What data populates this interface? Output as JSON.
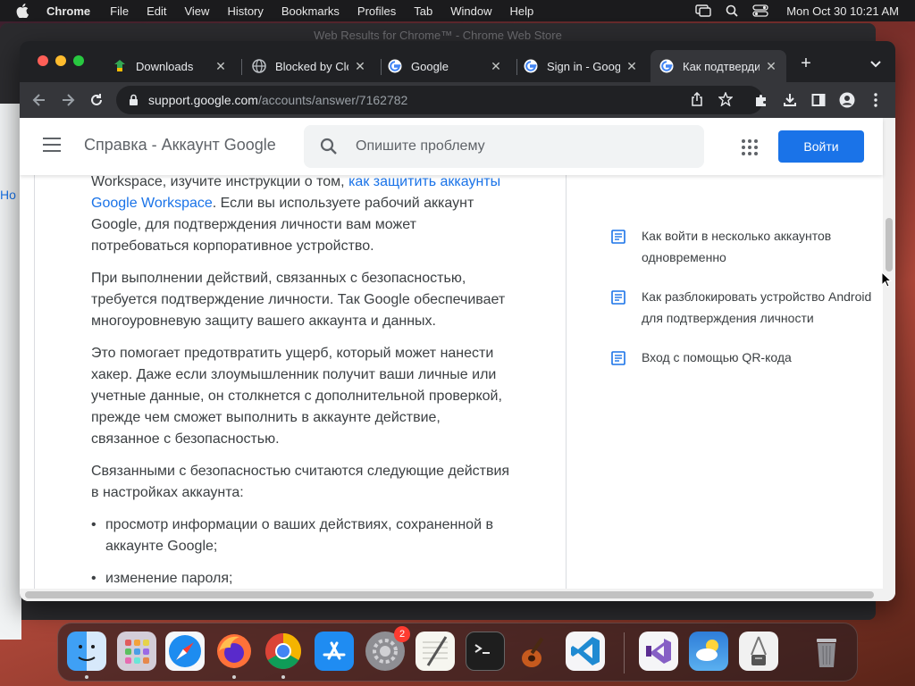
{
  "menubar": {
    "app_name": "Chrome",
    "items": [
      "File",
      "Edit",
      "View",
      "History",
      "Bookmarks",
      "Profiles",
      "Tab",
      "Window",
      "Help"
    ],
    "clock": "Mon Oct 30  10:21 AM"
  },
  "background_window": {
    "title": "Web Results for Chrome™ - Chrome Web Store",
    "partial_link": "Но"
  },
  "tabs": [
    {
      "title": "Downloads",
      "icon": "downloads-favicon"
    },
    {
      "title": "Blocked by Clo",
      "icon": "globe-favicon"
    },
    {
      "title": "Google",
      "icon": "google-favicon"
    },
    {
      "title": "Sign in - Googl",
      "icon": "google-favicon"
    },
    {
      "title": "Как подтверди",
      "icon": "google-favicon",
      "active": true
    }
  ],
  "address_bar": {
    "host": "support.google.com",
    "path": "/accounts/answer/7162782"
  },
  "help_header": {
    "title": "Справка - Аккаунт Google",
    "search_placeholder": "Опишите проблему",
    "signin_label": "Войти"
  },
  "article": {
    "p1_prefix": "Workspace, изучите инструкции о том, ",
    "p1_link": "как защитить аккаунты Google Workspace",
    "p1_suffix": ". Если вы используете рабочий аккаунт Google, для подтверждения личности вам может потребоваться корпоративное устройство.",
    "p2": "При выполнении действий, связанных с безопасностью, требуется подтверждение личности. Так Google обеспечивает многоуровневую защиту вашего аккаунта и данных.",
    "p3": "Это помогает предотвратить ущерб, который может нанести хакер. Даже если злоумышленник получит ваши личные или учетные данные, он столкнется с дополнительной проверкой, прежде чем сможет выполнить в аккаунте действие, связанное с безопасностью.",
    "p4": "Связанными с безопасностью считаются следующие действия в настройках аккаунта:",
    "bullets": [
      "просмотр информации о ваших действиях, сохраненной в аккаунте Google;",
      "изменение пароля;"
    ]
  },
  "related": [
    "Как войти в несколько аккаунтов одновременно",
    "Как разблокировать устройство Android для подтверждения личности",
    "Вход с помощью QR-кода"
  ],
  "dock": {
    "apps": [
      "finder",
      "launchpad",
      "safari",
      "firefox",
      "chrome",
      "app-store",
      "system-settings",
      "textedit",
      "terminal",
      "garageband",
      "vscode",
      "visual-studio",
      "weather",
      "archive-utility",
      "trash"
    ],
    "settings_badge": "2"
  },
  "colors": {
    "accent": "#1a73e8",
    "chrome_dark": "#35363a",
    "tabstrip": "#202124"
  }
}
